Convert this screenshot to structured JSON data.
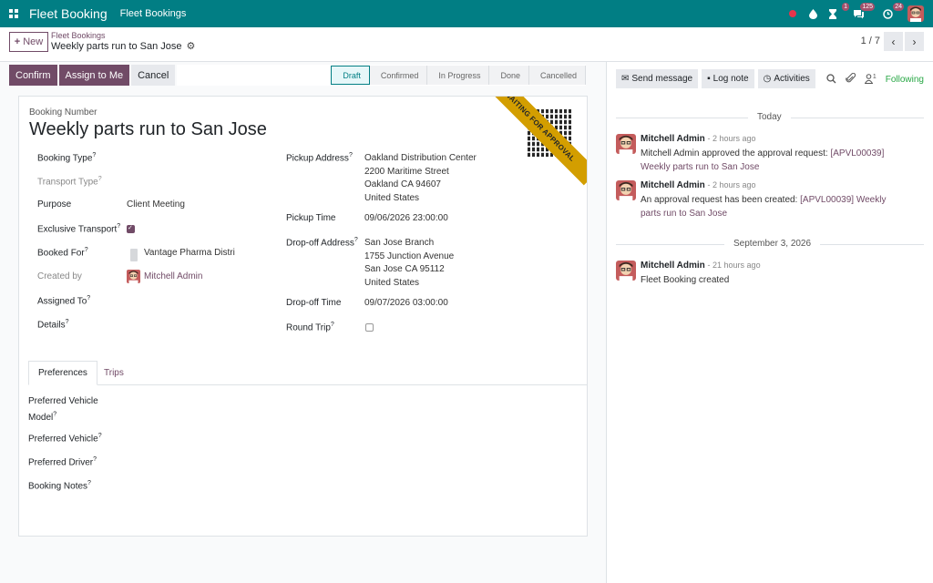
{
  "navbar": {
    "brand": "Fleet Booking",
    "menu": "Fleet Bookings",
    "activity_count": "1",
    "messages_count": "125",
    "timer_count": "24"
  },
  "control": {
    "new_label": "New",
    "breadcrumb": "Fleet Bookings",
    "record_title": "Weekly parts run to San Jose",
    "pager": "1 / 7"
  },
  "statusbar": {
    "buttons": [
      "Confirm",
      "Assign to Me",
      "Cancel"
    ],
    "stages": [
      "Draft",
      "Confirmed",
      "In Progress",
      "Done",
      "Cancelled"
    ],
    "active_stage": "Draft"
  },
  "ribbon": "WAITING FOR APPROVAL",
  "form": {
    "booking_number_label": "Booking Number",
    "booking_number": "Weekly parts run to San Jose",
    "left": {
      "booking_type": "Booking Type",
      "transport_type": "Transport Type",
      "purpose": "Purpose",
      "purpose_value": "Client Meeting",
      "exclusive_transport": "Exclusive Transport",
      "booked_for": "Booked For",
      "booked_for_value": "Vantage Pharma Distrib",
      "created_by": "Created by",
      "created_by_value": "Mitchell Admin",
      "assigned_to": "Assigned To",
      "details": "Details"
    },
    "right": {
      "pickup_address": "Pickup Address",
      "pickup_lines": [
        "Oakland Distribution Center",
        "2200 Maritime Street",
        "Oakland CA 94607",
        "United States"
      ],
      "pickup_time": "Pickup Time",
      "pickup_time_value": "09/06/2026 23:00:00",
      "dropoff_address": "Drop-off Address",
      "dropoff_lines": [
        "San Jose Branch",
        "1755 Junction Avenue",
        "San Jose CA 95112",
        "United States"
      ],
      "dropoff_time": "Drop-off Time",
      "dropoff_time_value": "09/07/2026 03:00:00",
      "round_trip": "Round Trip"
    },
    "tabs": [
      "Preferences",
      "Trips"
    ],
    "preferences": {
      "preferred_vehicle_model_1": "Preferred Vehicle",
      "preferred_vehicle_model_2": "Model",
      "preferred_vehicle": "Preferred Vehicle",
      "preferred_driver": "Preferred Driver",
      "booking_notes": "Booking Notes"
    }
  },
  "chatter": {
    "send_message": "Send message",
    "log_note": "Log note",
    "activities": "Activities",
    "followers_count": "1",
    "following": "Following",
    "date_today": "Today",
    "date_past": "September 3, 2026",
    "messages": [
      {
        "author": "Mitchell Admin",
        "time": "- 2 hours ago",
        "text": "Mitchell Admin approved the approval request: ",
        "link": "[APVL00039] Weekly parts run to San Jose"
      },
      {
        "author": "Mitchell Admin",
        "time": "- 2 hours ago",
        "text": "An approval request has been created: ",
        "link": "[APVL00039] Weekly parts run to San Jose"
      },
      {
        "author": "Mitchell Admin",
        "time": "- 21 hours ago",
        "text": "Fleet Booking created",
        "link": ""
      }
    ]
  }
}
